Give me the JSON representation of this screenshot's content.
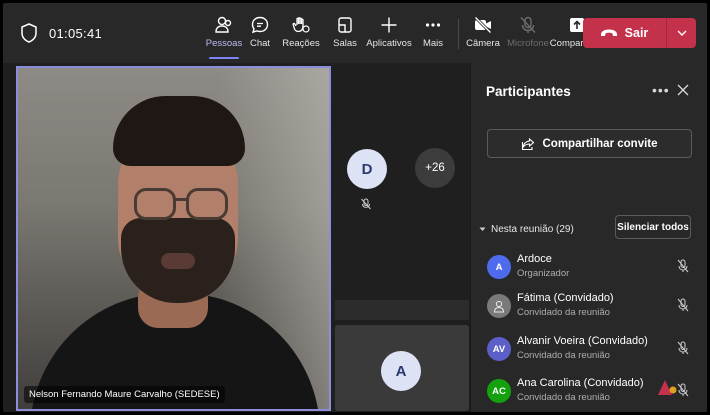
{
  "topbar": {
    "timer": "01:05:41",
    "buttons": {
      "people": "Pessoas",
      "chat": "Chat",
      "reactions": "Reações",
      "rooms": "Salas",
      "apps": "Aplicativos",
      "more": "Mais",
      "camera": "Câmera",
      "mic": "Microfone",
      "share": "Compartilhar"
    },
    "leave_label": "Sair",
    "active_button": "people",
    "leave_color": "#c4314b",
    "accent_color": "#7f85f5"
  },
  "stage": {
    "main_speaker_name": "Nelson Fernando Maure Carvalho (SEDESE)",
    "tile_d_initial": "D",
    "overflow_count": "+26",
    "tile_a_initial": "A"
  },
  "panel": {
    "title": "Participantes",
    "share_invite": "Compartilhar convite",
    "section_label": "Nesta reunião (29)",
    "mute_all": "Silenciar todos",
    "participants": [
      {
        "initials": "A",
        "name": "Ardoce",
        "role": "Organizador",
        "avatar_color": "#4f6bed",
        "mic": "muted"
      },
      {
        "initials": "",
        "name": "Fátima (Convidado)",
        "role": "Convidado da reunião",
        "avatar_color": "#7a7a7a",
        "avatar_icon": "person-icon",
        "mic": "muted"
      },
      {
        "initials": "AV",
        "name": "Alvanir Voeira (Convidado)",
        "role": "Convidado da reunião",
        "avatar_color": "#5b5fc7",
        "mic": "muted"
      },
      {
        "initials": "AC",
        "name": "Ana Carolina (Convidado)",
        "role": "Convidado da reunião",
        "avatar_color": "#13a10e",
        "mic": "muted"
      }
    ]
  }
}
